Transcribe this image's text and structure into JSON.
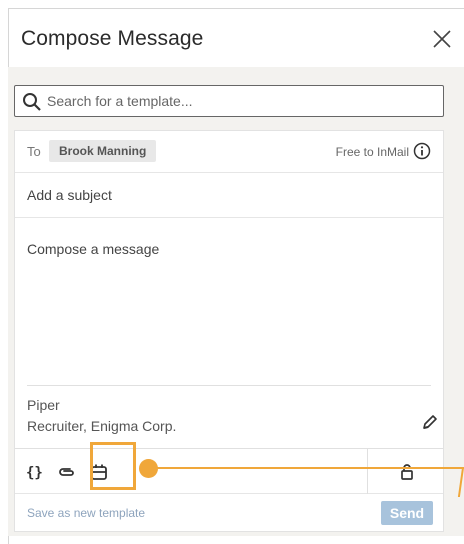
{
  "header": {
    "title": "Compose Message",
    "close_icon": "close-icon"
  },
  "search": {
    "placeholder": "Search for a template...",
    "value": ""
  },
  "recipient": {
    "to_label": "To",
    "name": "Brook Manning",
    "status": "Free to InMail",
    "info_icon": "info-icon"
  },
  "subject": {
    "placeholder": "Add a subject"
  },
  "message": {
    "placeholder": "Compose a message"
  },
  "signature": {
    "name": "Piper",
    "title": "Recruiter, Enigma Corp.",
    "edit_icon": "pencil-icon"
  },
  "toolbar": {
    "icons": [
      "insert-variable-icon",
      "attachment-icon",
      "calendar-icon",
      "lock-icon"
    ]
  },
  "footer": {
    "save_template": "Save as new template",
    "send_label": "Send"
  },
  "colors": {
    "accent": "#f0a73a",
    "send_disabled": "#a8c3dc",
    "link_muted": "#8ea4bd",
    "background": "#f3f2ef"
  }
}
